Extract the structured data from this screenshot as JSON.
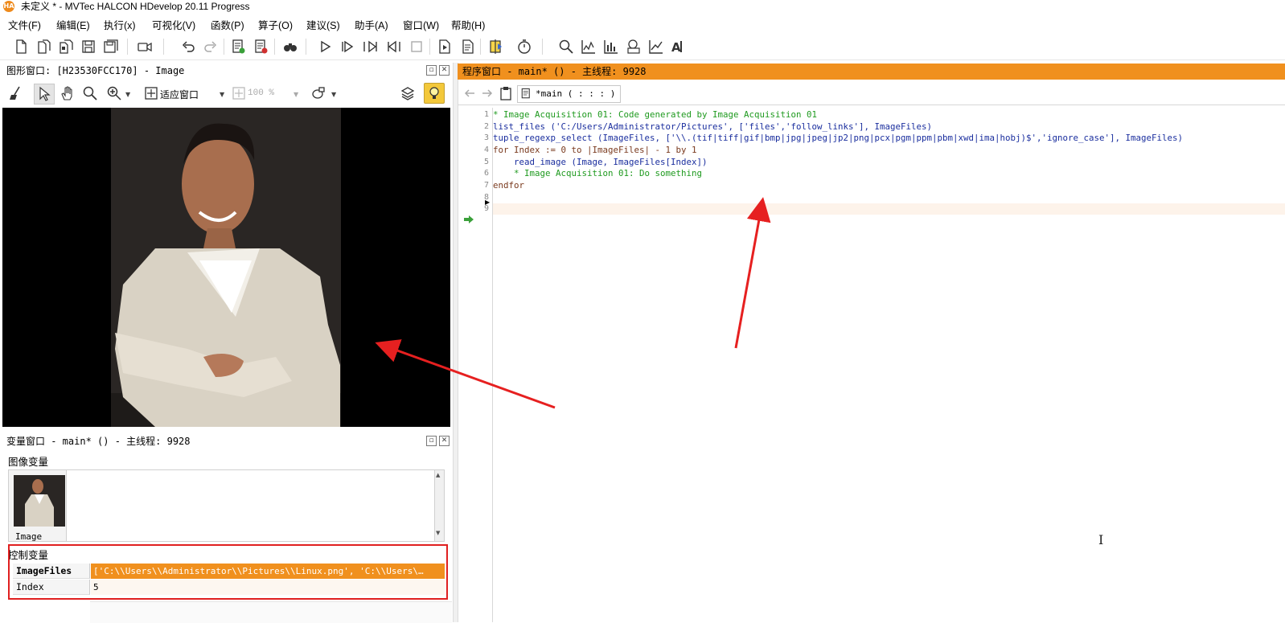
{
  "window": {
    "title": "未定义 * - MVTec HALCON HDevelop 20.11 Progress",
    "icon_text": "HA",
    "accent_color": "#f0901e"
  },
  "menu": [
    {
      "label": "文件(F)"
    },
    {
      "label": "编辑(E)"
    },
    {
      "label": "执行(x)"
    },
    {
      "label": "可视化(V)"
    },
    {
      "label": "函数(P)"
    },
    {
      "label": "算子(O)"
    },
    {
      "label": "建议(S)"
    },
    {
      "label": "助手(A)"
    },
    {
      "label": "窗口(W)"
    },
    {
      "label": "帮助(H)"
    }
  ],
  "graphics_window": {
    "title": "图形窗口: [H23530FCC170] - Image",
    "fit_label": "适应窗口",
    "zoom_label": "100 %"
  },
  "variable_window": {
    "title": "变量窗口 - main* () - 主线程: 9928",
    "image_section_label": "图像变量",
    "image_var_name": "Image",
    "control_section_label": "控制变量",
    "control_vars": [
      {
        "name": "ImageFiles",
        "value": "['C:\\\\Users\\\\Administrator\\\\Pictures\\\\Linux.png', 'C:\\\\Users\\…",
        "highlight_color": "#f0901e"
      },
      {
        "name": "Index",
        "value": "5"
      }
    ]
  },
  "program_window": {
    "title": "程序窗口 - main* () - 主线程: 9928",
    "procedure_label": "*main ( : : : )",
    "code_lines": [
      {
        "num": "1",
        "kind": "comment",
        "text": "* Image Acquisition 01: Code generated by Image Acquisition 01"
      },
      {
        "num": "2",
        "kind": "op",
        "text": "list_files ('C:/Users/Administrator/Pictures', ['files','follow_links'], ImageFiles)"
      },
      {
        "num": "3",
        "kind": "op",
        "text": "tuple_regexp_select (ImageFiles, ['\\\\.(tif|tiff|gif|bmp|jpg|jpeg|jp2|png|pcx|pgm|ppm|pbm|xwd|ima|hobj)$','ignore_case'], ImageFiles)"
      },
      {
        "num": "4",
        "kind": "ctrl",
        "text": "for Index := 0 to |ImageFiles| - 1 by 1"
      },
      {
        "num": "5",
        "kind": "op",
        "text": "    read_image (Image, ImageFiles[Index])"
      },
      {
        "num": "6",
        "kind": "comment",
        "text": "    * Image Acquisition 01: Do something"
      },
      {
        "num": "7",
        "kind": "ctrl",
        "text": "endfor"
      },
      {
        "num": "8",
        "kind": "op",
        "text": ""
      },
      {
        "num": "9",
        "kind": "op",
        "text": ""
      }
    ]
  },
  "icons": {
    "new": "new-file-icon",
    "open": "open-icon",
    "save": "save-icon",
    "record": "camera-icon",
    "undo": "undo-icon",
    "redo": "redo-icon",
    "find": "binoculars-icon",
    "run": "run-icon",
    "step": "step-icon",
    "stop": "stop-icon",
    "timer": "stopwatch-icon",
    "zoom": "zoom-icon",
    "histogram": "histogram-icon",
    "ocr": "ocr-icon",
    "pc-arrow": "program-counter-icon"
  }
}
